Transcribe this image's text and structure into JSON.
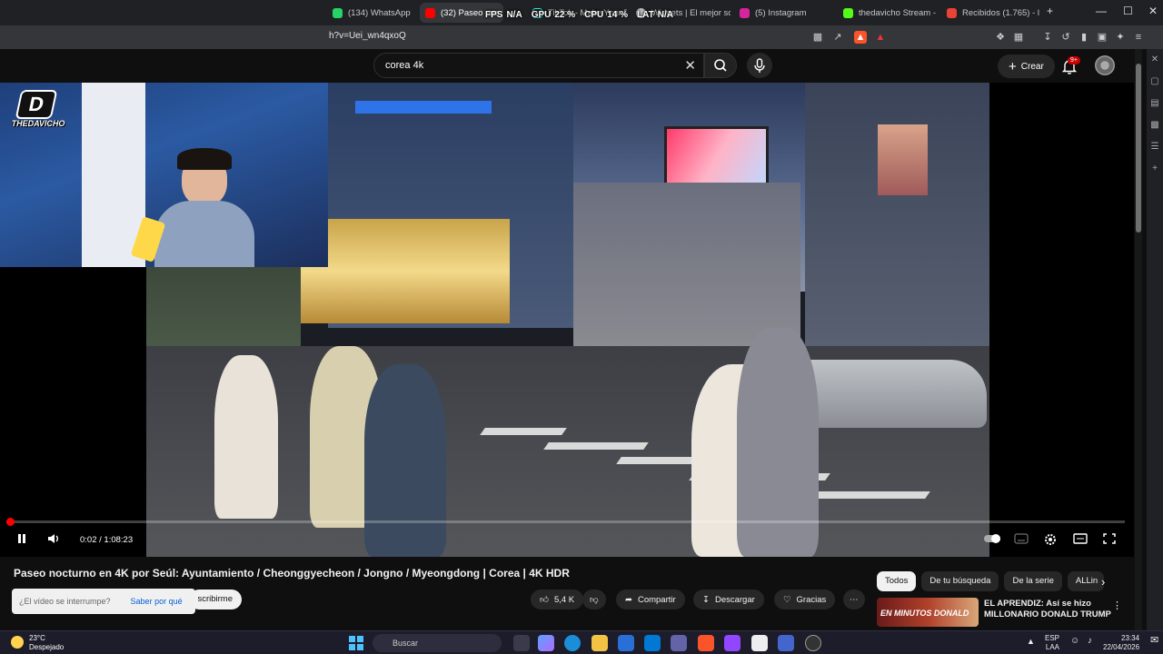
{
  "browser": {
    "tabs": [
      {
        "label": "(134) WhatsApp",
        "color": "#25d366"
      },
      {
        "label": "(32) Paseo noc",
        "color": "#ff0000"
      },
      {
        "label": "TikTok - Make Your D",
        "color": "#222222"
      },
      {
        "label": "Widgets | El mejor soft",
        "color": "#bbbbbb"
      },
      {
        "label": "(5) Instagram",
        "color": "#d6249f"
      },
      {
        "label": "thedavicho Stream - ",
        "color": "#53fc18"
      },
      {
        "label": "Recibidos (1.765) - luis",
        "color": "#ea4335"
      }
    ],
    "new_tab": "+",
    "url": "h?v=Uei_wn4qxoQ"
  },
  "hud": {
    "fps_label": "FPS",
    "fps_value": "N/A",
    "gpu_label": "GPU",
    "gpu_value": "22 %",
    "cpu_label": "CPU",
    "cpu_value": "14 %",
    "lat_label": "LAT",
    "lat_value": "N/A"
  },
  "youtube": {
    "search_value": "corea 4k",
    "create_label": "Crear",
    "notifications_badge": "9+"
  },
  "streamer": {
    "brand": "THEDAVICHO",
    "logo_letter": "D"
  },
  "player": {
    "time": "0:02 / 1:08:23",
    "progress": 0.0005
  },
  "video": {
    "title": "Paseo nocturno en 4K por Seúl: Ayuntamiento / Cheonggyecheon / Jongno / Myeongdong | Corea | 4K HDR",
    "toast_text": "¿El vídeo se interrumpe?",
    "toast_action": "Saber por qué",
    "subscribe_label": "scribirme",
    "likes": "5,4 K",
    "share_label": "Compartir",
    "download_label": "Descargar",
    "thanks_label": "Gracias"
  },
  "recommendations": {
    "chips": [
      "Todos",
      "De tu búsqueda",
      "De la serie",
      "ALLin"
    ],
    "items": [
      {
        "thumb_text": "EN MINUTOS DONALD",
        "title": "EL APRENDIZ: Así se hizo MILLONARIO DONALD TRUMP"
      }
    ]
  },
  "taskbar": {
    "temperature": "23°C",
    "weather": "Despejado",
    "search_placeholder": "Buscar",
    "lang_top": "ESP",
    "lang_bottom": "LAA",
    "time": "23:34",
    "date": "22/04/2026"
  },
  "colors": {
    "accent_red": "#ff0000",
    "yt_bg": "#0f0f0f",
    "link_blue": "#065fd4"
  }
}
